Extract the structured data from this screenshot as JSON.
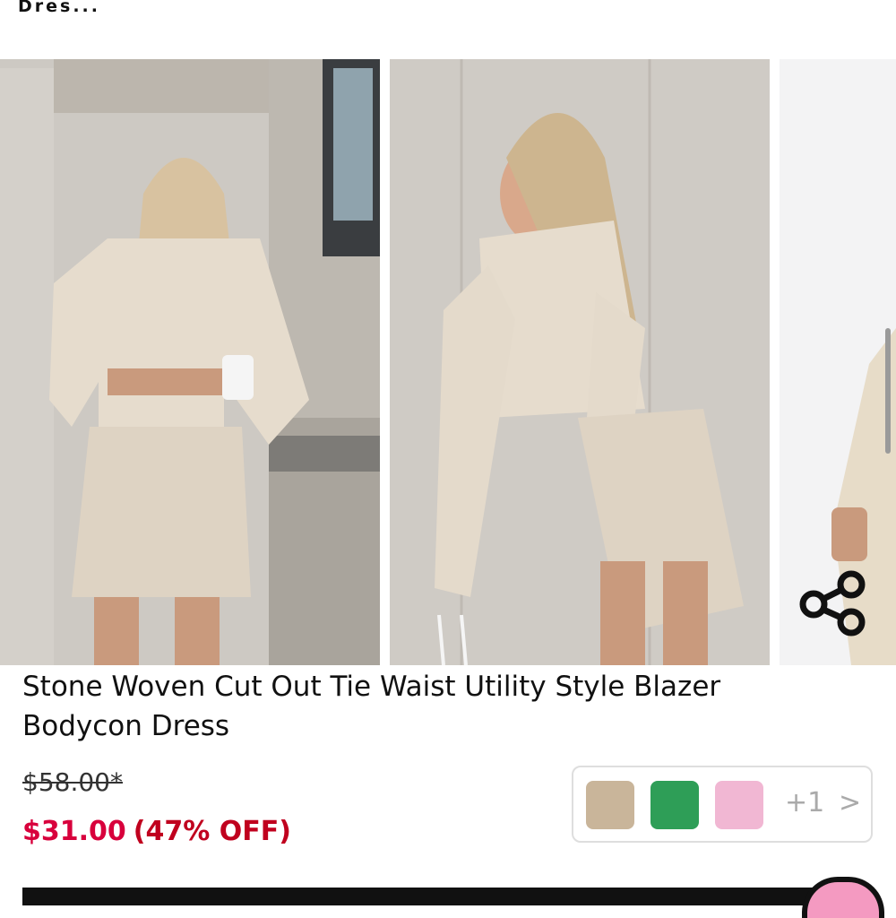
{
  "header": {
    "title": "Dres..."
  },
  "gallery": {
    "images": [
      {
        "alt": "Model wearing stone blazer dress standing by building"
      },
      {
        "alt": "Model wearing stone blazer dress leaning against wall"
      },
      {
        "alt": "Model wearing stone blazer dress, partial view"
      }
    ]
  },
  "icons": {
    "share": "share-icon"
  },
  "product": {
    "title": "Stone Woven Cut Out Tie Waist Utility Style Blazer Bodycon Dress",
    "original_price": "$58.00*",
    "sale_price": "$31.00",
    "discount": "(47% OFF)"
  },
  "swatches": {
    "colors": [
      "#c9b59a",
      "#2e9e57",
      "#f1b7d3"
    ],
    "more_label": "+1",
    "chevron": ">"
  },
  "colors": {
    "sale": "#d8003c",
    "discount": "#c0001e"
  }
}
